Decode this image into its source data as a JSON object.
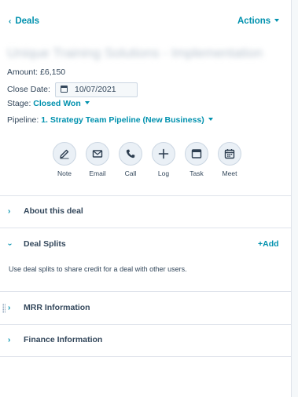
{
  "nav": {
    "back_chevron": "‹",
    "back_label": "Deals",
    "actions_label": "Actions"
  },
  "record": {
    "title": "Unique Training Solutions - Implementation"
  },
  "properties": {
    "amount_label": "Amount:",
    "amount_value": "£6,150",
    "close_date_label": "Close Date:",
    "close_date_value": "10/07/2021",
    "stage_label": "Stage:",
    "stage_value": "Closed Won",
    "pipeline_label": "Pipeline:",
    "pipeline_value": "1. Strategy Team Pipeline (New Business)"
  },
  "activity_actions": [
    {
      "label": "Note",
      "icon": "note-icon"
    },
    {
      "label": "Email",
      "icon": "email-icon"
    },
    {
      "label": "Call",
      "icon": "call-icon"
    },
    {
      "label": "Log",
      "icon": "log-icon"
    },
    {
      "label": "Task",
      "icon": "task-icon"
    },
    {
      "label": "Meet",
      "icon": "meet-icon"
    }
  ],
  "sections": {
    "about": {
      "title": "About this deal",
      "chevron": "›"
    },
    "splits": {
      "title": "Deal Splits",
      "chevron": "›",
      "add_label": "+Add",
      "description": "Use deal splits to share credit for a deal with other users."
    },
    "mrr": {
      "title": "MRR Information",
      "chevron": "›"
    },
    "finance": {
      "title": "Finance Information",
      "chevron": "›"
    }
  },
  "colors": {
    "link": "#0091ae",
    "text": "#33475b",
    "divider": "#dfe3eb",
    "icon_bg": "#eaf0f6"
  }
}
